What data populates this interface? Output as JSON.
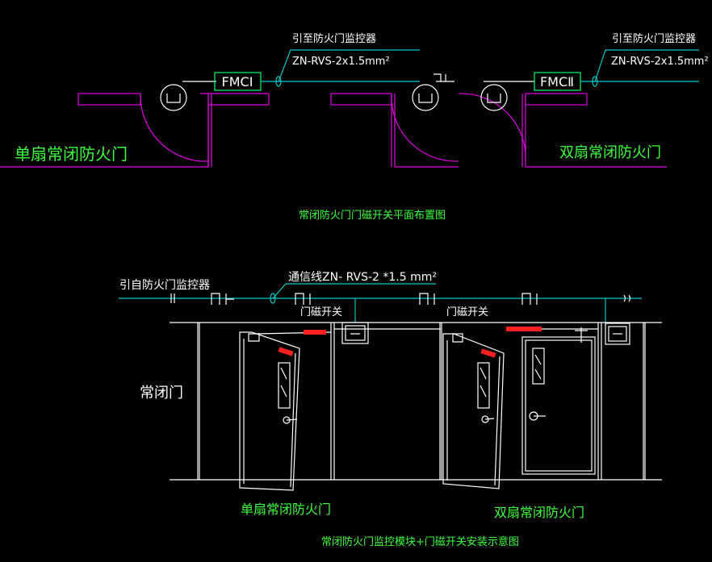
{
  "colors": {
    "background": "#000000",
    "wall_magenta": "#e000e0",
    "cable_cyan": "#00c8c8",
    "label_green": "#3cff3c",
    "line_white": "#ffffff",
    "module_green": "#00ff66",
    "magnet_red": "#ff2020"
  },
  "plan": {
    "title": "常闭防火门门磁开关平面布置图",
    "left": {
      "door_label": "单扇常闭防火门",
      "leader_label": "引至防火门监控器",
      "cable_spec": "ZN-RVS-2x1.5mm²",
      "module_label": "FMCⅠ"
    },
    "right": {
      "door_label": "双扇常闭防火门",
      "leader_label": "引至防火门监控器",
      "cable_spec": "ZN-RVS-2x1.5mm²",
      "module_label": "FMCⅡ"
    }
  },
  "elevation": {
    "title": "常闭防火门监控模块+门磁开关安装示意图",
    "source_label": "引自防火门监控器",
    "comm_cable": "通信线ZN- RVS-2 *1.5 mm²",
    "switch_left": "门磁开关",
    "switch_right": "门磁开关",
    "side_label": "常闭门",
    "door_left_label": "单扇常闭防火门",
    "door_right_label": "双扇常闭防火门"
  }
}
